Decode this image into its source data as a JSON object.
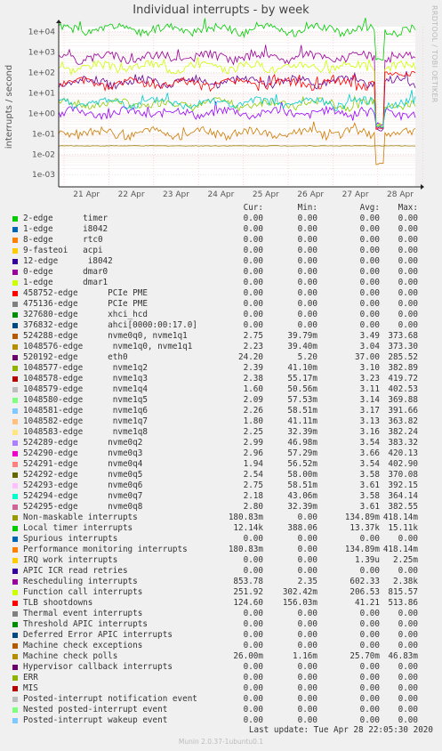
{
  "title": "Individual interrupts - by week",
  "side_label": "RRDTOOL / TOBI OETIKER",
  "footer": "Last update:  Tue Apr 28 22:05:30 2020",
  "munin_version": "Munin 2.0.37-1ubuntu0.1",
  "headers": {
    "cur": "Cur:",
    "min": "Min:",
    "avg": "Avg:",
    "max": "Max:"
  },
  "chart_data": {
    "type": "line",
    "title": "Individual interrupts - by week",
    "ylabel": "interrupts / second",
    "yscale": "log",
    "y_ticks": [
      "1e-03",
      "1e-02",
      "1e-01",
      "1e+00",
      "1e+01",
      "1e+02",
      "1e+03",
      "1e+04"
    ],
    "x_ticks": [
      "21 Apr",
      "22 Apr",
      "23 Apr",
      "24 Apr",
      "25 Apr",
      "26 Apr",
      "27 Apr",
      "28 Apr"
    ],
    "grid": true,
    "series": [
      {
        "name": "Local timer interrupts",
        "color": "#00CC00",
        "level": 13370,
        "seed": 1,
        "dip": true,
        "dipval": 420
      },
      {
        "name": "Rescheduling interrupts",
        "color": "#990099",
        "level": 600,
        "seed": 2,
        "dip": true,
        "dipval": 0.2
      },
      {
        "name": "Function call interrupts",
        "color": "#CCFF00",
        "level": 200,
        "seed": 3,
        "dip": true,
        "dipval": 0.3
      },
      {
        "name": "520192-edge eth0",
        "color": "#660099",
        "level": 37,
        "seed": 4,
        "dip": true,
        "dipval": 0.15
      },
      {
        "name": "TLB shootdowns",
        "color": "#FF0000",
        "level": 30,
        "seed": 5,
        "dip": true,
        "dipval": 0.2,
        "rise": true
      },
      {
        "name": "Non-maskable interrupts",
        "color": "#9900FF",
        "level": 1.1,
        "seed": 6,
        "dip": true,
        "dipval": 0.3
      },
      {
        "name": "1048577-edge nvme1q2",
        "color": "#8FCC00",
        "level": 3,
        "seed": 7,
        "dip": true,
        "dipval": 0.25
      },
      {
        "name": "524289-edge nvme0q2",
        "color": "#00CCCC",
        "level": 3.4,
        "seed": 8,
        "dip": true,
        "dipval": 0.25
      },
      {
        "name": "524288-edge nvme0q0, nvme1q1",
        "color": "#CC7A00",
        "level": 0.11,
        "seed": 9,
        "dip": true,
        "dipval": 0.003
      },
      {
        "name": "Machine check polls",
        "color": "#997A00",
        "level": 0.0257,
        "seed": 10,
        "dip": false,
        "flat": true
      }
    ]
  },
  "rows": [
    {
      "label": "2-edge      timer",
      "color": "#00CC00",
      "cur": "0.00",
      "min": "0.00",
      "avg": "0.00",
      "max": "0.00"
    },
    {
      "label": "1-edge      i8042",
      "color": "#0066B3",
      "cur": "0.00",
      "min": "0.00",
      "avg": "0.00",
      "max": "0.00"
    },
    {
      "label": "8-edge      rtc0",
      "color": "#FF8000",
      "cur": "0.00",
      "min": "0.00",
      "avg": "0.00",
      "max": "0.00"
    },
    {
      "label": "9-fasteoi   acpi",
      "color": "#FFCC00",
      "cur": "0.00",
      "min": "0.00",
      "avg": "0.00",
      "max": "0.00"
    },
    {
      "label": "12-edge      i8042",
      "color": "#330099",
      "cur": "0.00",
      "min": "0.00",
      "avg": "0.00",
      "max": "0.00"
    },
    {
      "label": "0-edge      dmar0",
      "color": "#990099",
      "cur": "0.00",
      "min": "0.00",
      "avg": "0.00",
      "max": "0.00"
    },
    {
      "label": "1-edge      dmar1",
      "color": "#CCFF00",
      "cur": "0.00",
      "min": "0.00",
      "avg": "0.00",
      "max": "0.00"
    },
    {
      "label": "458752-edge      PCIe PME",
      "color": "#FF0000",
      "cur": "0.00",
      "min": "0.00",
      "avg": "0.00",
      "max": "0.00"
    },
    {
      "label": "475136-edge      PCIe PME",
      "color": "#808080",
      "cur": "0.00",
      "min": "0.00",
      "avg": "0.00",
      "max": "0.00"
    },
    {
      "label": "327680-edge      xhci_hcd",
      "color": "#008F00",
      "cur": "0.00",
      "min": "0.00",
      "avg": "0.00",
      "max": "0.00"
    },
    {
      "label": "376832-edge      ahci[0000:00:17.0]",
      "color": "#00487D",
      "cur": "0.00",
      "min": "0.00",
      "avg": "0.00",
      "max": "0.00"
    },
    {
      "label": "524288-edge      nvme0q0, nvme1q1",
      "color": "#B35A00",
      "cur": "2.75",
      "min": "39.79m",
      "avg": "3.49",
      "max": "373.68"
    },
    {
      "label": "1048576-edge      nvme1q0, nvme1q1",
      "color": "#B38F00",
      "cur": "2.23",
      "min": "39.40m",
      "avg": "3.04",
      "max": "373.30"
    },
    {
      "label": "520192-edge      eth0",
      "color": "#6B006B",
      "cur": "24.20",
      "min": "5.20",
      "avg": "37.00",
      "max": "285.52"
    },
    {
      "label": "1048577-edge      nvme1q2",
      "color": "#8FB300",
      "cur": "2.39",
      "min": "41.10m",
      "avg": "3.10",
      "max": "382.89"
    },
    {
      "label": "1048578-edge      nvme1q3",
      "color": "#B30000",
      "cur": "2.38",
      "min": "55.17m",
      "avg": "3.23",
      "max": "419.72"
    },
    {
      "label": "1048579-edge      nvme1q4",
      "color": "#BEBEBE",
      "cur": "1.60",
      "min": "50.56m",
      "avg": "3.11",
      "max": "402.53"
    },
    {
      "label": "1048580-edge      nvme1q5",
      "color": "#80FF80",
      "cur": "2.09",
      "min": "57.53m",
      "avg": "3.14",
      "max": "369.88"
    },
    {
      "label": "1048581-edge      nvme1q6",
      "color": "#80C9FF",
      "cur": "2.26",
      "min": "58.51m",
      "avg": "3.17",
      "max": "391.66"
    },
    {
      "label": "1048582-edge      nvme1q7",
      "color": "#FFC080",
      "cur": "1.80",
      "min": "41.11m",
      "avg": "3.13",
      "max": "363.82"
    },
    {
      "label": "1048583-edge      nvme1q8",
      "color": "#FFE680",
      "cur": "2.25",
      "min": "32.39m",
      "avg": "3.16",
      "max": "382.24"
    },
    {
      "label": "524289-edge      nvme0q2",
      "color": "#AA80FF",
      "cur": "2.99",
      "min": "46.98m",
      "avg": "3.54",
      "max": "383.32"
    },
    {
      "label": "524290-edge      nvme0q3",
      "color": "#EE00CC",
      "cur": "2.96",
      "min": "57.29m",
      "avg": "3.66",
      "max": "420.13"
    },
    {
      "label": "524291-edge      nvme0q4",
      "color": "#FF8080",
      "cur": "1.94",
      "min": "56.52m",
      "avg": "3.54",
      "max": "402.90"
    },
    {
      "label": "524292-edge      nvme0q5",
      "color": "#666600",
      "cur": "2.54",
      "min": "58.00m",
      "avg": "3.58",
      "max": "370.08"
    },
    {
      "label": "524293-edge      nvme0q6",
      "color": "#FFBFFF",
      "cur": "2.75",
      "min": "58.51m",
      "avg": "3.61",
      "max": "392.15"
    },
    {
      "label": "524294-edge      nvme0q7",
      "color": "#00FFCC",
      "cur": "2.18",
      "min": "43.06m",
      "avg": "3.58",
      "max": "364.14"
    },
    {
      "label": "524295-edge      nvme0q8",
      "color": "#CC6699",
      "cur": "2.80",
      "min": "32.39m",
      "avg": "3.61",
      "max": "382.55"
    },
    {
      "label": "Non-maskable interrupts",
      "color": "#999900",
      "cur": "180.83m",
      "min": "0.00",
      "avg": "134.89m",
      "max": "418.14m"
    },
    {
      "label": "Local timer interrupts",
      "color": "#00CC00",
      "cur": "12.14k",
      "min": "388.06",
      "avg": "13.37k",
      "max": "15.11k"
    },
    {
      "label": "Spurious interrupts",
      "color": "#0066B3",
      "cur": "0.00",
      "min": "0.00",
      "avg": "0.00",
      "max": "0.00"
    },
    {
      "label": "Performance monitoring interrupts",
      "color": "#FF8000",
      "cur": "180.83m",
      "min": "0.00",
      "avg": "134.89m",
      "max": "418.14m"
    },
    {
      "label": "IRQ work interrupts",
      "color": "#FFCC00",
      "cur": "0.00",
      "min": "0.00",
      "avg": "1.39u",
      "max": "2.25m"
    },
    {
      "label": "APIC ICR read retries",
      "color": "#330099",
      "cur": "0.00",
      "min": "0.00",
      "avg": "0.00",
      "max": "0.00"
    },
    {
      "label": "Rescheduling interrupts",
      "color": "#990099",
      "cur": "853.78",
      "min": "2.35",
      "avg": "602.33",
      "max": "2.38k"
    },
    {
      "label": "Function call interrupts",
      "color": "#CCFF00",
      "cur": "251.92",
      "min": "302.42m",
      "avg": "206.53",
      "max": "815.57"
    },
    {
      "label": "TLB shootdowns",
      "color": "#FF0000",
      "cur": "124.60",
      "min": "156.03m",
      "avg": "41.21",
      "max": "513.86"
    },
    {
      "label": "Thermal event interrupts",
      "color": "#808080",
      "cur": "0.00",
      "min": "0.00",
      "avg": "0.00",
      "max": "0.00"
    },
    {
      "label": "Threshold APIC interrupts",
      "color": "#008F00",
      "cur": "0.00",
      "min": "0.00",
      "avg": "0.00",
      "max": "0.00"
    },
    {
      "label": "Deferred Error APIC interrupts",
      "color": "#00487D",
      "cur": "0.00",
      "min": "0.00",
      "avg": "0.00",
      "max": "0.00"
    },
    {
      "label": "Machine check exceptions",
      "color": "#B35A00",
      "cur": "0.00",
      "min": "0.00",
      "avg": "0.00",
      "max": "0.00"
    },
    {
      "label": "Machine check polls",
      "color": "#B38F00",
      "cur": "26.00m",
      "min": "1.16m",
      "avg": "25.70m",
      "max": "46.83m"
    },
    {
      "label": "Hypervisor callback interrupts",
      "color": "#6B006B",
      "cur": "0.00",
      "min": "0.00",
      "avg": "0.00",
      "max": "0.00"
    },
    {
      "label": "ERR",
      "color": "#8FB300",
      "cur": "0.00",
      "min": "0.00",
      "avg": "0.00",
      "max": "0.00"
    },
    {
      "label": "MIS",
      "color": "#B30000",
      "cur": "0.00",
      "min": "0.00",
      "avg": "0.00",
      "max": "0.00"
    },
    {
      "label": "Posted-interrupt notification event",
      "color": "#BEBEBE",
      "cur": "0.00",
      "min": "0.00",
      "avg": "0.00",
      "max": "0.00"
    },
    {
      "label": "Nested posted-interrupt event",
      "color": "#80FF80",
      "cur": "0.00",
      "min": "0.00",
      "avg": "0.00",
      "max": "0.00"
    },
    {
      "label": "Posted-interrupt wakeup event",
      "color": "#80C9FF",
      "cur": "0.00",
      "min": "0.00",
      "avg": "0.00",
      "max": "0.00"
    }
  ]
}
